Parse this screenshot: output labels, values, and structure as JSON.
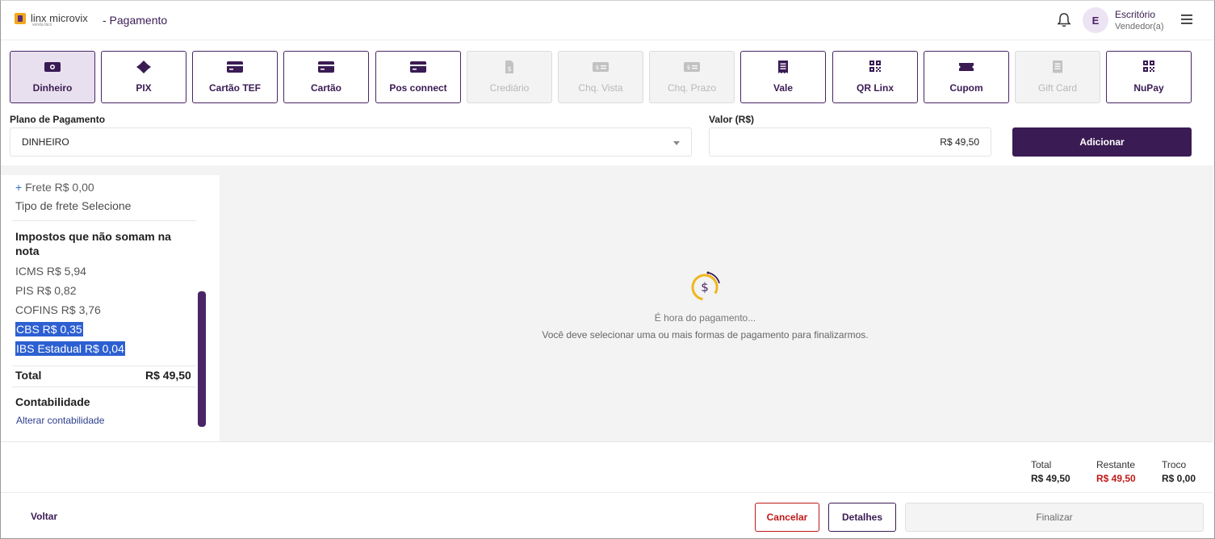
{
  "header": {
    "brand": "linx microvix",
    "brand_sub": "venda fácil",
    "page_title": "- Pagamento",
    "avatar_initial": "E",
    "user_name": "Escritório",
    "user_role": "Vendedor(a)"
  },
  "methods": [
    {
      "label": "Dinheiro",
      "icon": "cash-icon",
      "state": "active"
    },
    {
      "label": "PIX",
      "icon": "pix-icon",
      "state": "enabled"
    },
    {
      "label": "Cartão TEF",
      "icon": "card-icon",
      "state": "enabled"
    },
    {
      "label": "Cartão",
      "icon": "card-icon",
      "state": "enabled"
    },
    {
      "label": "Pos connect",
      "icon": "card-icon",
      "state": "enabled"
    },
    {
      "label": "Crediário",
      "icon": "document-dollar-icon",
      "state": "disabled"
    },
    {
      "label": "Chq. Vista",
      "icon": "check-icon",
      "state": "disabled"
    },
    {
      "label": "Chq. Prazo",
      "icon": "check-icon",
      "state": "disabled"
    },
    {
      "label": "Vale",
      "icon": "receipt-icon",
      "state": "enabled"
    },
    {
      "label": "QR Linx",
      "icon": "qr-code-icon",
      "state": "enabled"
    },
    {
      "label": "Cupom",
      "icon": "ticket-icon",
      "state": "enabled"
    },
    {
      "label": "Gift Card",
      "icon": "receipt-icon",
      "state": "disabled"
    },
    {
      "label": "NuPay",
      "icon": "qr-code-icon",
      "state": "enabled"
    }
  ],
  "form": {
    "plan_label": "Plano de Pagamento",
    "plan_value": "DINHEIRO",
    "valor_label": "Valor (R$)",
    "valor_value": "R$ 49,50",
    "add_label": "Adicionar"
  },
  "summary": {
    "freight": "Frete R$ 0,00",
    "freight_plus": "+",
    "freight_type": "Tipo de frete Selecione",
    "tax_title": "Impostos que não somam na nota",
    "icms": "ICMS R$ 5,94",
    "pis": "PIS R$ 0,82",
    "cofins": "COFINS R$ 3,76",
    "cbs": "CBS R$ 0,35",
    "ibs": "IBS Estadual R$ 0,04",
    "total_label": "Total",
    "total_value": "R$ 49,50",
    "contab_title": "Contabilidade",
    "contab_link": "Alterar contabilidade"
  },
  "empty": {
    "title": "É hora do pagamento...",
    "subtitle": "Você deve selecionar uma ou mais formas de pagamento para finalizarmos."
  },
  "totals": {
    "total_label": "Total",
    "total_value": "R$ 49,50",
    "restante_label": "Restante",
    "restante_value": "R$ 49,50",
    "troco_label": "Troco",
    "troco_value": "R$ 0,00"
  },
  "footer": {
    "back_label": "Voltar",
    "cancel_label": "Cancelar",
    "details_label": "Detalhes",
    "finalize_label": "Finalizar"
  },
  "colors": {
    "primary": "#3a1b54",
    "active_bg": "#e8e0ee",
    "danger": "#c01919",
    "selection": "#2c5fd1"
  }
}
